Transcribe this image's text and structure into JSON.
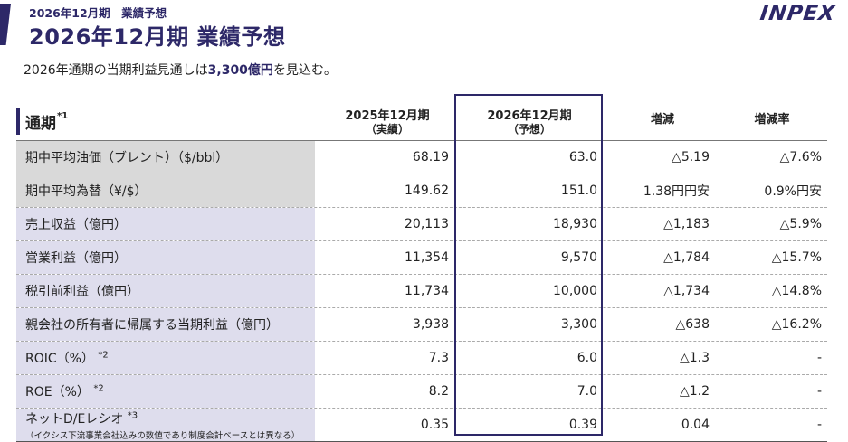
{
  "header": {
    "subtitle": "2026年12月期　業績予想",
    "title": "2026年12月期 業績予想",
    "logo": "INPEX"
  },
  "lead": {
    "before": "2026年通期の当期利益見通しは",
    "highlight": "3,300億円",
    "after": "を見込む。"
  },
  "table": {
    "section_label": "通期",
    "section_note": "*1",
    "columns": [
      {
        "line1": "2025年12月期",
        "line2": "（実績）"
      },
      {
        "line1": "2026年12月期",
        "line2": "（予想）"
      },
      {
        "line1": "増減",
        "line2": ""
      },
      {
        "line1": "増減率",
        "line2": ""
      }
    ],
    "rows": [
      {
        "label": "期中平均油価（ブレント）（$/bbl）",
        "sup": "",
        "note": "",
        "shade": "gray",
        "v2025": "68.19",
        "v2026": "63.0",
        "diff": "△5.19",
        "rate": "△7.6%"
      },
      {
        "label": "期中平均為替（¥/$）",
        "sup": "",
        "note": "",
        "shade": "gray",
        "v2025": "149.62",
        "v2026": "151.0",
        "diff": "1.38円円安",
        "rate": "0.9%円安"
      },
      {
        "label": "売上収益（億円）",
        "sup": "",
        "note": "",
        "shade": "lav",
        "v2025": "20,113",
        "v2026": "18,930",
        "diff": "△1,183",
        "rate": "△5.9%"
      },
      {
        "label": "営業利益（億円）",
        "sup": "",
        "note": "",
        "shade": "lav",
        "v2025": "11,354",
        "v2026": "9,570",
        "diff": "△1,784",
        "rate": "△15.7%"
      },
      {
        "label": "税引前利益（億円）",
        "sup": "",
        "note": "",
        "shade": "lav",
        "v2025": "11,734",
        "v2026": "10,000",
        "diff": "△1,734",
        "rate": "△14.8%"
      },
      {
        "label": "親会社の所有者に帰属する当期利益（億円）",
        "sup": "",
        "note": "",
        "shade": "lav",
        "v2025": "3,938",
        "v2026": "3,300",
        "diff": "△638",
        "rate": "△16.2%"
      },
      {
        "label": "ROIC（%）",
        "sup": "*2",
        "note": "",
        "shade": "lav",
        "v2025": "7.3",
        "v2026": "6.0",
        "diff": "△1.3",
        "rate": "-"
      },
      {
        "label": "ROE（%）",
        "sup": "*2",
        "note": "",
        "shade": "lav",
        "v2025": "8.2",
        "v2026": "7.0",
        "diff": "△1.2",
        "rate": "-"
      },
      {
        "label": "ネットD/Eレシオ",
        "sup": "*3",
        "note": "（イクシス下流事業会社込みの数値であり制度会計ベースとは異なる）",
        "shade": "lav",
        "v2025": "0.35",
        "v2026": "0.39",
        "diff": "0.04",
        "rate": "-"
      }
    ]
  },
  "colors": {
    "brand": "#2d2868",
    "gray_label": "#d9d9d9",
    "lavender_label": "#dedded"
  }
}
